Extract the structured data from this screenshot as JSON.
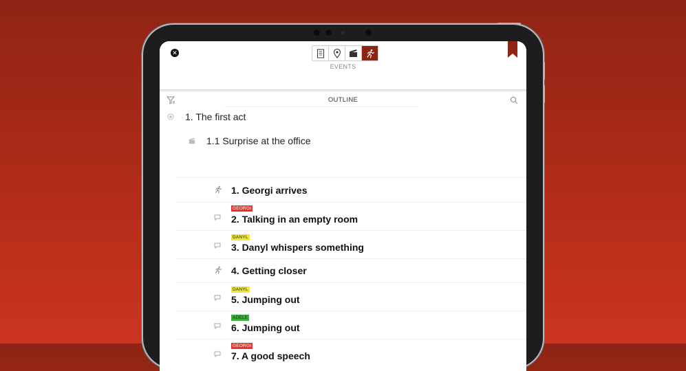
{
  "toolbar": {
    "tabs": [
      {
        "name": "document",
        "icon": "document-icon"
      },
      {
        "name": "places",
        "icon": "location-pin-icon"
      },
      {
        "name": "scenes",
        "icon": "clapperboard-icon"
      },
      {
        "name": "events",
        "icon": "running-person-icon",
        "active": true
      }
    ],
    "mode_label": "EVENTS"
  },
  "outline": {
    "title": "OUTLINE",
    "act": {
      "label": "1. The first act",
      "icon": "target-icon"
    },
    "sequence": {
      "label": "1.1 Surprise at the office",
      "icon": "clapperboard-icon"
    },
    "items": [
      {
        "title": "1. Georgi arrives",
        "type": "action",
        "icon": "running-person-icon"
      },
      {
        "title": "2. Talking in an empty room",
        "type": "dialogue",
        "icon": "speech-bubble-icon",
        "tag": "GEORGI",
        "tag_color": "#e3352a"
      },
      {
        "title": "3. Danyl whispers something",
        "type": "dialogue",
        "icon": "speech-bubble-icon",
        "tag": "DANYL",
        "tag_color": "#f1e43a"
      },
      {
        "title": "4. Getting closer",
        "type": "action",
        "icon": "running-person-icon"
      },
      {
        "title": "5. Jumping out",
        "type": "dialogue",
        "icon": "speech-bubble-icon",
        "tag": "DANYL",
        "tag_color": "#f1e43a"
      },
      {
        "title": "6. Jumping out",
        "type": "dialogue",
        "icon": "speech-bubble-icon",
        "tag": "ADELE",
        "tag_color": "#3fae3f"
      },
      {
        "title": "7. A good speech",
        "type": "dialogue",
        "icon": "speech-bubble-icon",
        "tag": "GEORGI",
        "tag_color": "#e3352a"
      }
    ]
  },
  "colors": {
    "accent": "#8e2413",
    "background_top": "#8f2414",
    "background_bottom": "#cc3520"
  }
}
